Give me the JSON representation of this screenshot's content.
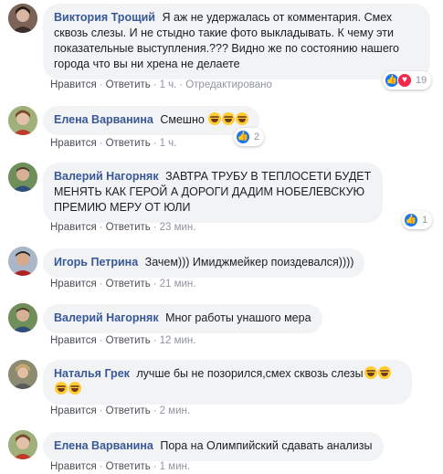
{
  "comments": [
    {
      "author": "Виктория Трощий",
      "text": "Я аж не удержалась от комментария. Смех сквозь слезы. И не стыдно такие фото выкладывать. К чему эти показательные выступления.??? Видно же по состоянию нашего города что вы ни хрена не делаете",
      "like": "Нравится",
      "reply": "Ответить",
      "time": "1 ч.",
      "edited": "Отредактировано",
      "reaction_count": "19"
    },
    {
      "author": "Елена Варванина",
      "text": "Смешно",
      "like": "Нравится",
      "reply": "Ответить",
      "time": "1 ч.",
      "reaction_count": "2"
    },
    {
      "author": "Валерий Нагорняк",
      "text": "ЗАВТРА ТРУБУ В ТЕПЛОСЕТИ БУДЕТ МЕНЯТЬ КАК ГЕРОЙ А ДОРОГИ ДАДИМ НОБЕЛЕВСКУЮ ПРЕМИЮ МЕРУ ОТ ЮЛИ",
      "like": "Нравится",
      "reply": "Ответить",
      "time": "23 мин.",
      "reaction_count": "1"
    },
    {
      "author": "Игорь Петрина",
      "text": "Зачем))) Имиджмейкер поиздевался))))",
      "like": "Нравится",
      "reply": "Ответить",
      "time": "21 мин."
    },
    {
      "author": "Валерий Нагорняк",
      "text": "Мног работы унашого мера",
      "like": "Нравится",
      "reply": "Ответить",
      "time": "12 мин."
    },
    {
      "author": "Наталья Грек",
      "text": "лучше бы не позорился,смех сквозь слезы",
      "like": "Нравится",
      "reply": "Ответить",
      "time": "2 мин."
    },
    {
      "author": "Елена Варванина",
      "text": "Пора на Олимпийский сдавать анализы",
      "like": "Нравится",
      "reply": "Ответить",
      "time": "1 мин."
    }
  ],
  "icons": {
    "like": "thumbs-up-icon",
    "love": "heart-icon",
    "laugh": "laughing-emoji-icon"
  },
  "colors": {
    "author": "#385898",
    "bubble": "#f2f3f5",
    "like": "#1877f2",
    "love": "#f0284a"
  }
}
